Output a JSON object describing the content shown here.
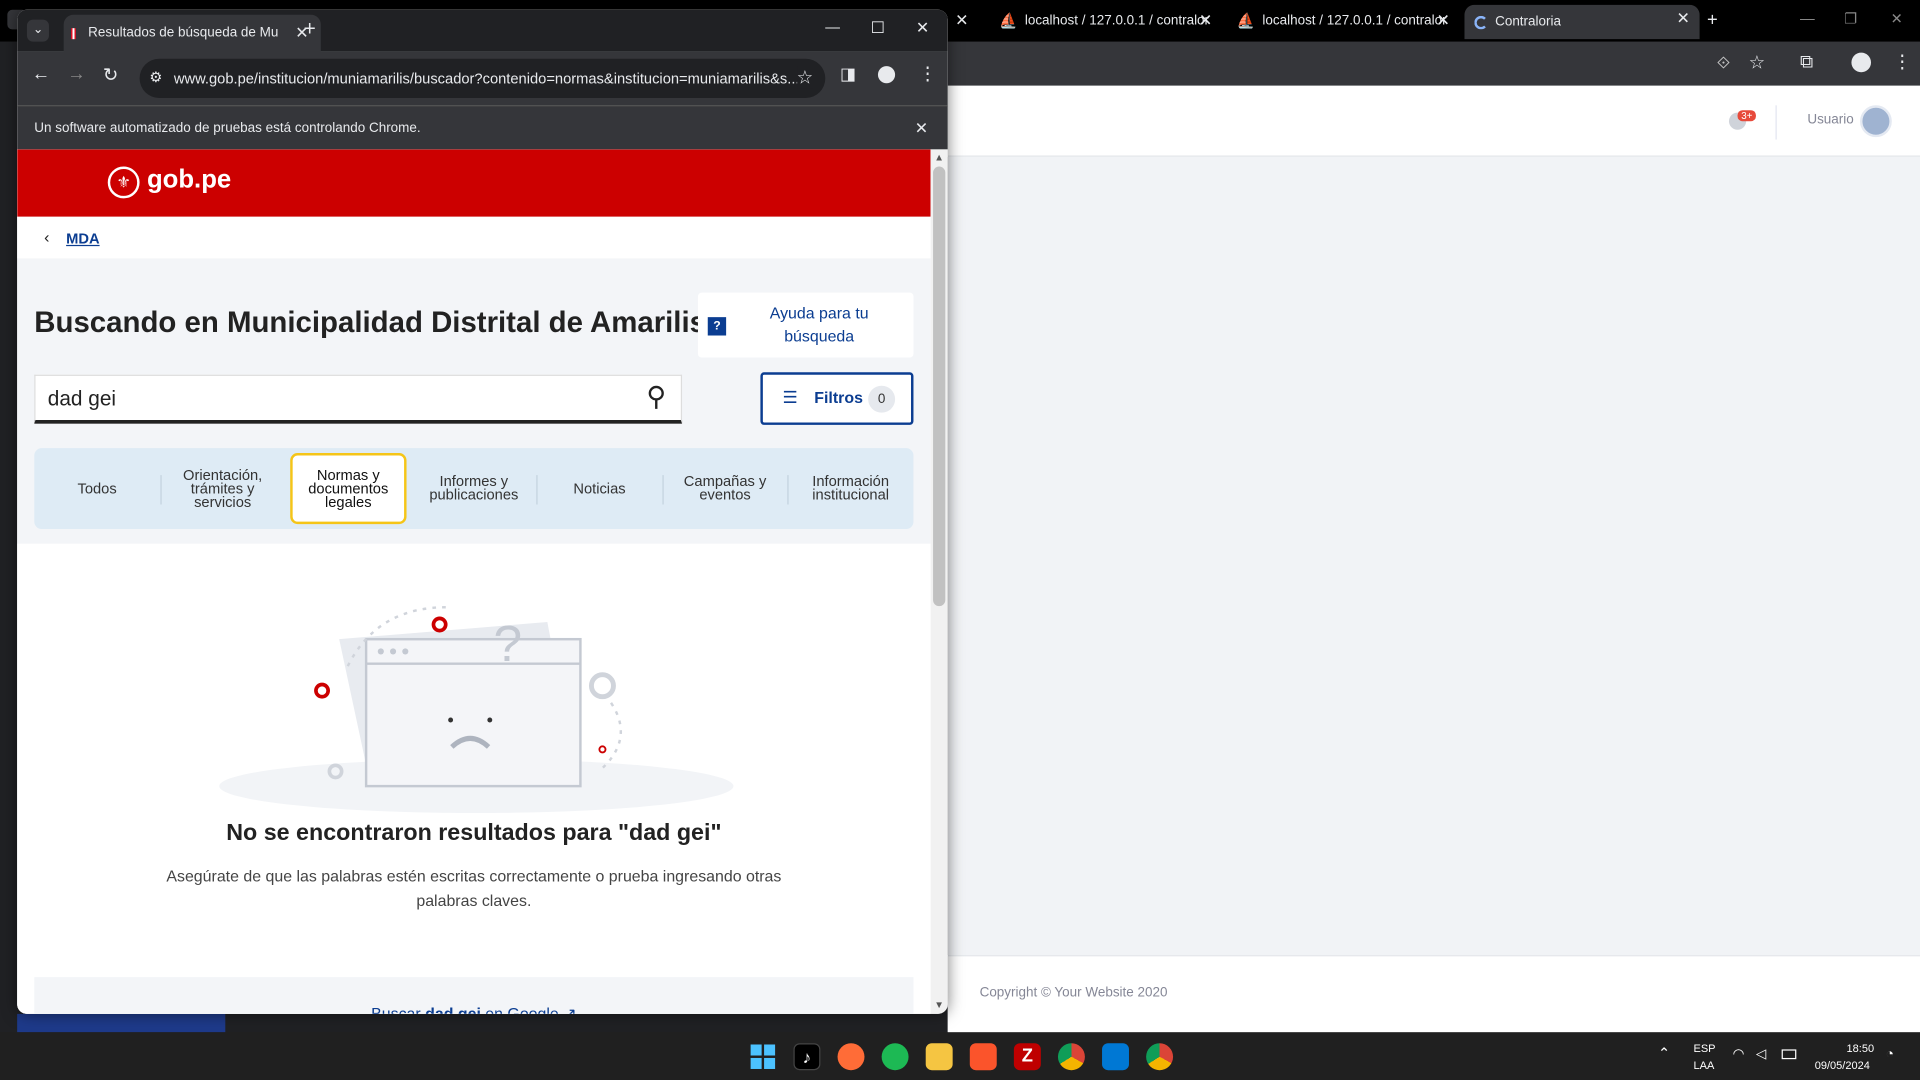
{
  "background_window": {
    "tabs": [
      {
        "label": "localhost / 127.0.0.1 / contralor"
      },
      {
        "label": "localhost / 127.0.0.1 / contralor"
      },
      {
        "label": "Contraloria"
      }
    ],
    "header": {
      "notification_badge": "3+",
      "user_label": "Usuario"
    },
    "footer": {
      "copyright": "Copyright © Your Website 2020"
    }
  },
  "browser": {
    "tab_title": "Resultados de búsqueda de Mu",
    "url": "www.gob.pe/institucion/muniamarilis/buscador?contenido=normas&institucion=muniamarilis&s...",
    "automation_notice": "Un software automatizado de pruebas está controlando Chrome."
  },
  "page": {
    "logo_text": "gob.pe",
    "breadcrumb": "MDA",
    "title": "Buscando en Municipalidad Distrital de Amarilis",
    "help_icon_text": "?",
    "help_label_line1": "Ayuda para tu",
    "help_label_line2": "búsqueda",
    "search_value": "dad gei",
    "filters_label": "Filtros",
    "filters_count": "0",
    "categories": [
      [
        "Todos"
      ],
      [
        "Orientación,",
        "trámites y",
        "servicios"
      ],
      [
        "Normas y",
        "documentos",
        "legales"
      ],
      [
        "Informes y",
        "publicaciones"
      ],
      [
        "Noticias"
      ],
      [
        "Campañas y",
        "eventos"
      ],
      [
        "Información",
        "institucional"
      ]
    ],
    "selected_category_index": 2,
    "no_results_title": "No se encontraron resultados para \"dad gei\"",
    "no_results_text_line1": "Asegúrate de que las palabras estén escritas correctamente o prueba ingresando otras",
    "no_results_text_line2": "palabras claves.",
    "google_prefix": "Buscar ",
    "google_term": "dad gei",
    "google_suffix": " en Google"
  },
  "taskbar": {
    "language_line1": "ESP",
    "language_line2": "LAA",
    "time": "18:50",
    "date": "09/05/2024"
  },
  "colors": {
    "gob_red": "#cc0000",
    "gob_blue": "#0b3d91",
    "tab_highlight": "#f5c518"
  }
}
